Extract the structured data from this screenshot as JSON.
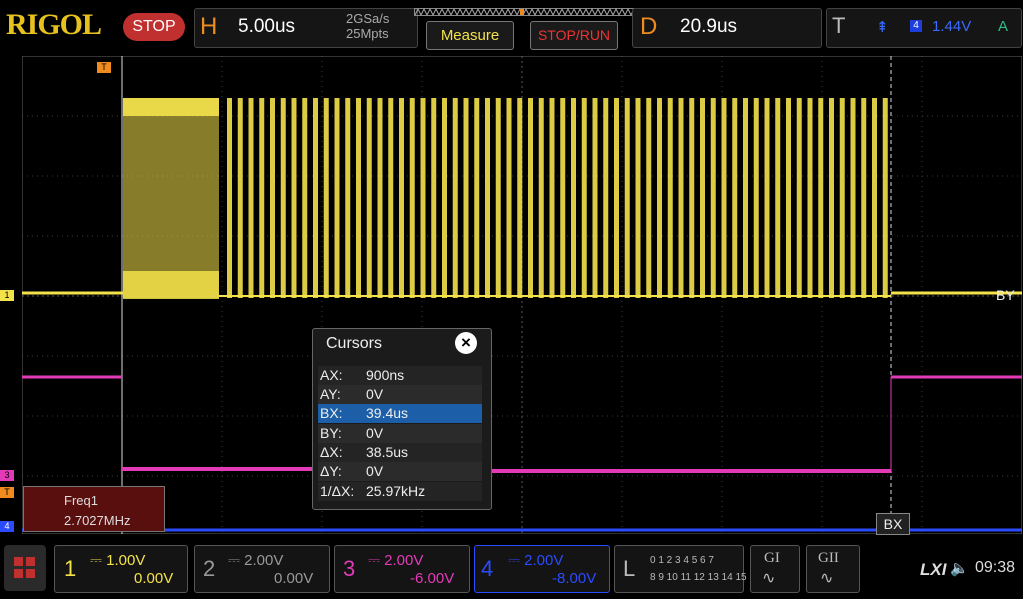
{
  "header": {
    "logo": "RIGOL",
    "run_state": "STOP",
    "horizontal": {
      "letter": "H",
      "timebase": "5.00us",
      "sample_rate": "2GSa/s",
      "memory_depth": "25Mpts"
    },
    "measure_label": "Measure",
    "stoprun_label": "STOP/RUN",
    "delay": {
      "letter": "D",
      "value": "20.9us"
    },
    "trigger": {
      "letter": "T",
      "slope": "⇞",
      "source": "4",
      "level": "1.44V",
      "mode": "A"
    }
  },
  "markers": {
    "trigger_pos": "T",
    "ch1": "1",
    "ch3": "3",
    "trig_level": "T",
    "ch4": "4",
    "bx": "BX",
    "by": "BY"
  },
  "cursors": {
    "title": "Cursors",
    "close": "×",
    "rows": [
      {
        "key": "AX:",
        "value": "900ns"
      },
      {
        "key": "AY:",
        "value": "0V"
      },
      {
        "key": "BX:",
        "value": "39.4us",
        "selected": true
      },
      {
        "key": "BY:",
        "value": "0V"
      },
      {
        "key": "ΔX:",
        "value": "38.5us"
      },
      {
        "key": "ΔY:",
        "value": "0V"
      },
      {
        "key": "1/ΔX:",
        "value": "25.97kHz"
      }
    ]
  },
  "measurement": {
    "label": "Freq1",
    "value": "2.7027MHz"
  },
  "channels": [
    {
      "num": "1",
      "scale": "1.00V",
      "offset": "0.00V",
      "color": "#f4e24a"
    },
    {
      "num": "2",
      "scale": "2.00V",
      "offset": "0.00V",
      "color": "#999999"
    },
    {
      "num": "3",
      "scale": "2.00V",
      "offset": "-6.00V",
      "color": "#e33ab8"
    },
    {
      "num": "4",
      "scale": "2.00V",
      "offset": "-8.00V",
      "color": "#2b4bff"
    }
  ],
  "logic": {
    "letter": "L",
    "row1": "0 1 2 3   4 5 6 7",
    "row2": "8 9 10 11 12 13 14 15"
  },
  "decode": [
    {
      "label": "GI"
    },
    {
      "label": "GII"
    }
  ],
  "status": {
    "lxi": "LXI",
    "speaker": "🔈",
    "time": "09:38"
  },
  "colors": {
    "ch1": "#f4e24a",
    "ch3": "#e33ab8",
    "ch4": "#2b4bff",
    "accent": "#f08c1e",
    "selected_row": "#1c5fa8"
  }
}
